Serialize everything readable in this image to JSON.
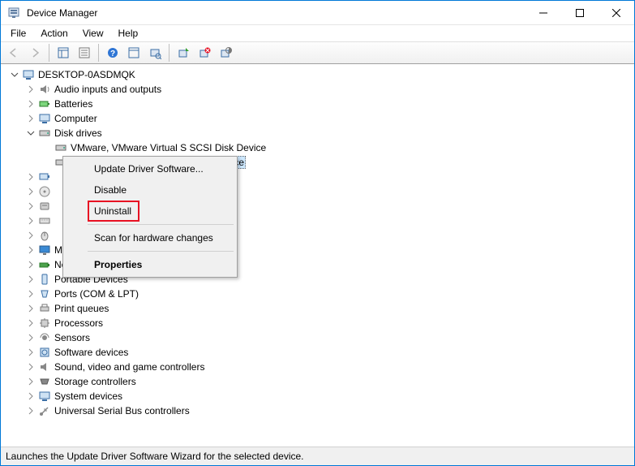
{
  "window": {
    "title": "Device Manager"
  },
  "menu": {
    "file": "File",
    "action": "Action",
    "view": "View",
    "help": "Help"
  },
  "tree": {
    "root": "DESKTOP-0ASDMQK",
    "audio": "Audio inputs and outputs",
    "batteries": "Batteries",
    "computer": "Computer",
    "disk_drives": "Disk drives",
    "disk1": "VMware, VMware Virtual S SCSI Disk Device",
    "disk2_suffix": "ce",
    "monitors": "Monitors",
    "network": "Network adapters",
    "portable": "Portable Devices",
    "ports": "Ports (COM & LPT)",
    "print_queues": "Print queues",
    "processors": "Processors",
    "sensors": "Sensors",
    "software": "Software devices",
    "sound": "Sound, video and game controllers",
    "storage": "Storage controllers",
    "system": "System devices",
    "usb": "Universal Serial Bus controllers",
    "hidden1": "",
    "hidden2": "",
    "hidden3": "",
    "hidden4": "",
    "hidden5": ""
  },
  "context_menu": {
    "update": "Update Driver Software...",
    "disable": "Disable",
    "uninstall": "Uninstall",
    "scan": "Scan for hardware changes",
    "properties": "Properties"
  },
  "status": "Launches the Update Driver Software Wizard for the selected device."
}
